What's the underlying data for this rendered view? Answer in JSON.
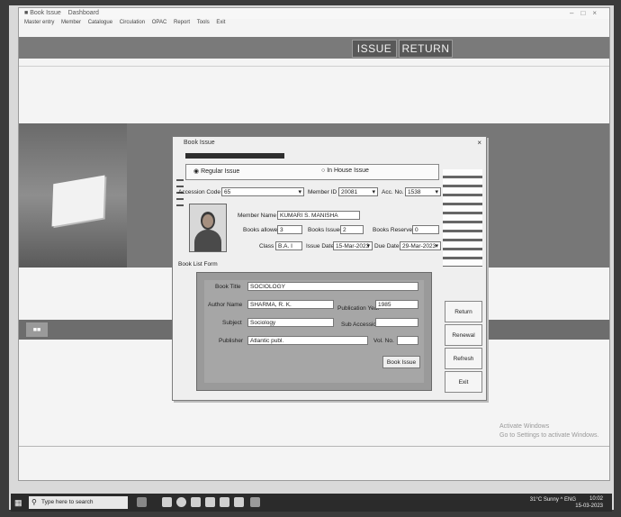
{
  "window": {
    "title": "Book Issue",
    "subtitle": "Dashboard",
    "menu": [
      "Master entry",
      "Member",
      "Catalogue",
      "Circulation",
      "OPAC",
      "Report",
      "Tools",
      "Exit"
    ]
  },
  "ribbon": {
    "issue_label": "ISSUE",
    "return_label": "RETURN"
  },
  "dialog": {
    "title": "Book Issue",
    "tabs": {
      "regular": "Regular Issue",
      "in_house": "In House Issue"
    },
    "accession_code_label": "Accession Code",
    "accession_code_value": "65",
    "member_id_label": "Member ID",
    "member_id_value": "20081",
    "acc_no_label": "Acc. No.",
    "acc_no_value": "1538",
    "member_name_label": "Member Name",
    "member_name_value": "KUMARI S. MANISHA",
    "books_allowed_label": "Books allowed",
    "books_allowed_value": "3",
    "books_issued_label": "Books Issued",
    "books_issued_value": "2",
    "books_reserved_label": "Books Reserved",
    "books_reserved_value": "0",
    "class_label": "Class",
    "class_value": "B.A. I",
    "issue_date_label": "Issue Date",
    "issue_date_value": "15-Mar-2023",
    "due_date_label": "Due Date",
    "due_date_value": "29-Mar-2023",
    "book_list_label": "Book List Form",
    "book_title_label": "Book Title",
    "book_title_value": "SOCIOLOGY",
    "author_name_label": "Author Name",
    "author_name_value": "SHARMA, R. K.",
    "pub_year_label": "Publication Year",
    "pub_year_value": "1985",
    "subject_label": "Subject",
    "subject_value": "Sociology",
    "sub_accession_label": "Sub Accession",
    "sub_accession_value": "",
    "publisher_label": "Publisher",
    "publisher_value": "Atlantic publ.",
    "vol_no_label": "Vol. No.",
    "vol_no_value": "",
    "book_issue_button": "Book Issue",
    "side_buttons": [
      "Return",
      "Renewal",
      "Refresh",
      "Exit"
    ]
  },
  "watermark": {
    "line1": "Activate Windows",
    "line2": "Go to Settings to activate Windows."
  },
  "taskbar": {
    "search_placeholder": "Type here to search",
    "tray": "31°C Sunny  ^  ENG",
    "time": "10:02",
    "date": "15-03-2023"
  },
  "colors": {
    "ribbon": "#7a7a7a",
    "dialog_bg": "#efefef",
    "list_panel": "#9a9a9a"
  }
}
